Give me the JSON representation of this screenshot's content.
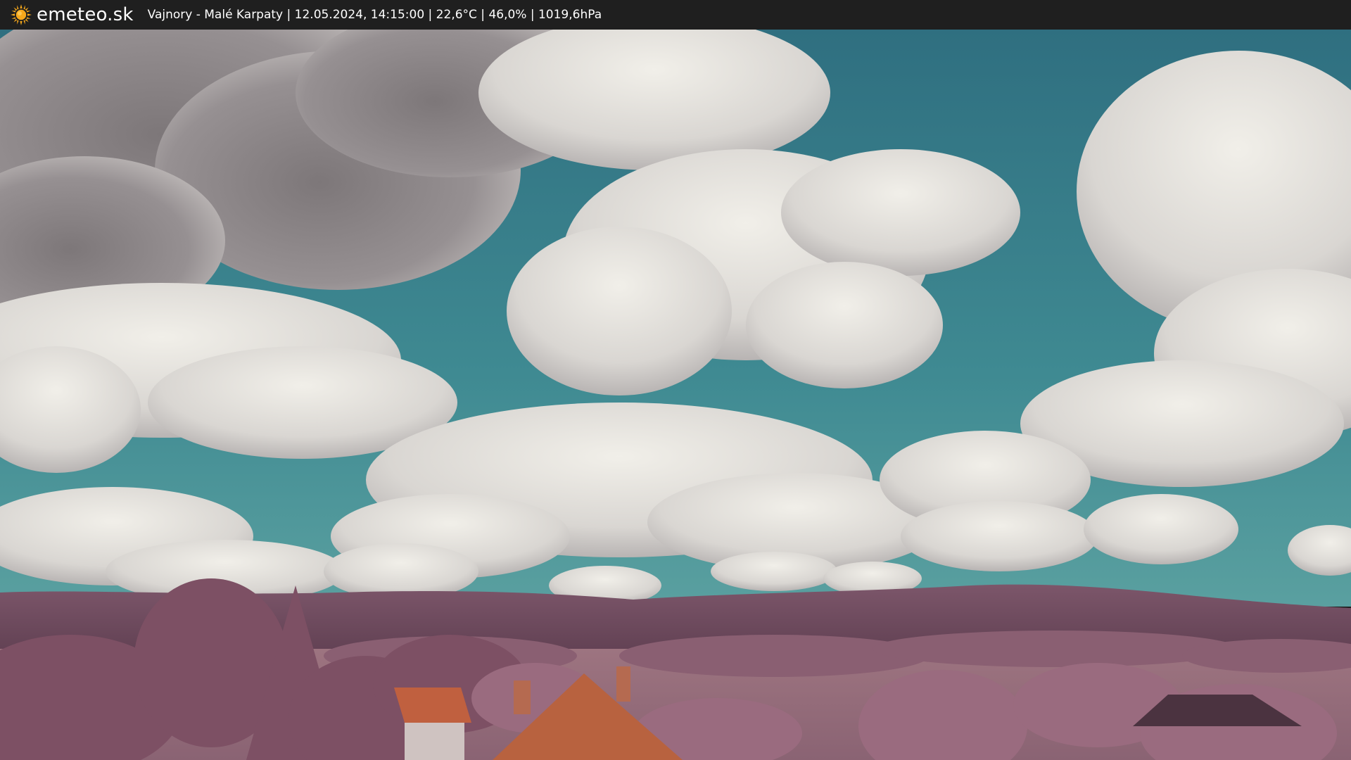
{
  "topbar": {
    "brand": {
      "icon": "sun-icon",
      "name": "emeteo.sk",
      "icon_color": "#f7a81b"
    },
    "caption": "Vajnory - Malé Karpaty | 12.05.2024, 14:15:00 | 22,6°C | 46,0% | 1019,6hPa"
  },
  "colors": {
    "bar_background": "#1f1f1f",
    "sky": "#3b7f8a",
    "vegetation": "#9a6a7e",
    "hills": "#6e4a5e",
    "roof": "#c0603f"
  }
}
